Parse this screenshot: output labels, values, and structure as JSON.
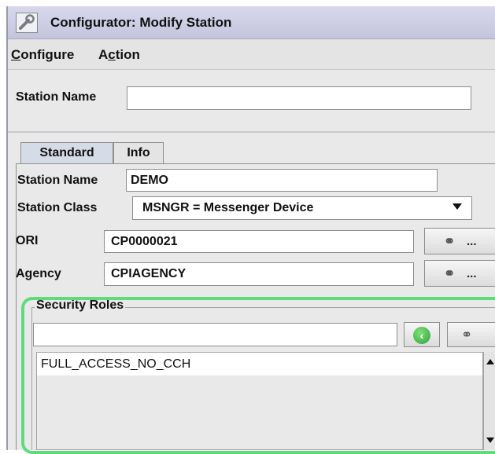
{
  "window": {
    "title": "Configurator: Modify Station",
    "app_icon": "wrench-icon"
  },
  "menu": [
    {
      "label": "Configure"
    },
    {
      "label": "Action"
    }
  ],
  "search": {
    "station_name_label": "Station Name",
    "station_name_value": ""
  },
  "tabs": [
    {
      "label": "Standard",
      "active": true
    },
    {
      "label": "Info",
      "active": false
    }
  ],
  "form": {
    "station_name": {
      "label": "Station Name",
      "value": "DEMO"
    },
    "station_class": {
      "label": "Station Class",
      "value": "MSNGR = Messenger Device"
    },
    "ori": {
      "label": "ORI",
      "value": "CP0000021",
      "button_label": "..."
    },
    "agency": {
      "label": "Agency",
      "value": "CPIAGENCY",
      "button_label": "..."
    }
  },
  "security_roles": {
    "title": "Security Roles",
    "input_value": "",
    "items": [
      "FULL_ACCESS_NO_CCH"
    ]
  },
  "colors": {
    "highlight": "#5fdc7a",
    "active_tab": "#d6dbe8",
    "titlebar": "#c8c8e2"
  }
}
